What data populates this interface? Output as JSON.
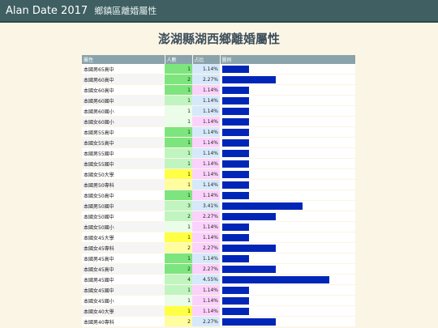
{
  "app": {
    "title": "Alan Date 2017",
    "subtitle": "鄉鎮區離婚屬性"
  },
  "page": {
    "heading": "澎湖縣湖西鄉離婚屬性"
  },
  "table": {
    "columns": [
      "屬性",
      "人數",
      "占比",
      "圖例"
    ],
    "max_value": 4,
    "colors": {
      "count_yellow": "#ffff44",
      "count_green_dark": "#7de57d",
      "count_green_mid": "#c0f5c0",
      "count_green_light": "#eafde8",
      "pct_pink": "#fbd2fb",
      "pct_blue": "#d6e9fb",
      "bar": "#0026b8"
    },
    "rows": [
      {
        "name": "本國男65高中",
        "count": "1",
        "pct": "1.14%",
        "value": 1,
        "count_color": "#7de57d",
        "pct_color": "#d6e9fb"
      },
      {
        "name": "本國男60高中",
        "count": "2",
        "pct": "2.27%",
        "value": 2,
        "count_color": "#7de57d",
        "pct_color": "#d6e9fb"
      },
      {
        "name": "本國女60高中",
        "count": "1",
        "pct": "1.14%",
        "value": 1,
        "count_color": "#7de57d",
        "pct_color": "#fbd2fb"
      },
      {
        "name": "本國男60國中",
        "count": "1",
        "pct": "1.14%",
        "value": 1,
        "count_color": "#c0f5c0",
        "pct_color": "#d6e9fb"
      },
      {
        "name": "本國男60國小",
        "count": "1",
        "pct": "1.14%",
        "value": 1,
        "count_color": "#eafde8",
        "pct_color": "#d6e9fb"
      },
      {
        "name": "本國女60國小",
        "count": "1",
        "pct": "1.14%",
        "value": 1,
        "count_color": "#eafde8",
        "pct_color": "#fbd2fb"
      },
      {
        "name": "本國男55高中",
        "count": "1",
        "pct": "1.14%",
        "value": 1,
        "count_color": "#7de57d",
        "pct_color": "#d6e9fb"
      },
      {
        "name": "本國女55高中",
        "count": "1",
        "pct": "1.14%",
        "value": 1,
        "count_color": "#7de57d",
        "pct_color": "#fbd2fb"
      },
      {
        "name": "本國男55國中",
        "count": "1",
        "pct": "1.14%",
        "value": 1,
        "count_color": "#c0f5c0",
        "pct_color": "#d6e9fb"
      },
      {
        "name": "本國女55國中",
        "count": "1",
        "pct": "1.14%",
        "value": 1,
        "count_color": "#c0f5c0",
        "pct_color": "#fbd2fb"
      },
      {
        "name": "本國女50大學",
        "count": "1",
        "pct": "1.14%",
        "value": 1,
        "count_color": "#ffff44",
        "pct_color": "#fbd2fb"
      },
      {
        "name": "本國男50專科",
        "count": "1",
        "pct": "1.14%",
        "value": 1,
        "count_color": "#fffd9e",
        "pct_color": "#d6e9fb"
      },
      {
        "name": "本國女50高中",
        "count": "1",
        "pct": "1.14%",
        "value": 1,
        "count_color": "#7de57d",
        "pct_color": "#fbd2fb"
      },
      {
        "name": "本國男50國中",
        "count": "3",
        "pct": "3.41%",
        "value": 3,
        "count_color": "#c0f5c0",
        "pct_color": "#d6e9fb"
      },
      {
        "name": "本國女50國中",
        "count": "2",
        "pct": "2.27%",
        "value": 2,
        "count_color": "#c0f5c0",
        "pct_color": "#fbd2fb"
      },
      {
        "name": "本國女50國小",
        "count": "1",
        "pct": "1.14%",
        "value": 1,
        "count_color": "#eafde8",
        "pct_color": "#fbd2fb"
      },
      {
        "name": "本國女45大學",
        "count": "1",
        "pct": "1.14%",
        "value": 1,
        "count_color": "#ffff44",
        "pct_color": "#fbd2fb"
      },
      {
        "name": "本國女45專科",
        "count": "2",
        "pct": "2.27%",
        "value": 2,
        "count_color": "#fffd9e",
        "pct_color": "#fbd2fb"
      },
      {
        "name": "本國男45高中",
        "count": "1",
        "pct": "1.14%",
        "value": 1,
        "count_color": "#7de57d",
        "pct_color": "#d6e9fb"
      },
      {
        "name": "本國女45高中",
        "count": "2",
        "pct": "2.27%",
        "value": 2,
        "count_color": "#7de57d",
        "pct_color": "#fbd2fb"
      },
      {
        "name": "本國男45國中",
        "count": "4",
        "pct": "4.55%",
        "value": 4,
        "count_color": "#c0f5c0",
        "pct_color": "#d6e9fb"
      },
      {
        "name": "本國女45國中",
        "count": "1",
        "pct": "1.14%",
        "value": 1,
        "count_color": "#c0f5c0",
        "pct_color": "#fbd2fb"
      },
      {
        "name": "本國女45國小",
        "count": "1",
        "pct": "1.14%",
        "value": 1,
        "count_color": "#eafde8",
        "pct_color": "#fbd2fb"
      },
      {
        "name": "本國女40大學",
        "count": "1",
        "pct": "1.14%",
        "value": 1,
        "count_color": "#ffff44",
        "pct_color": "#fbd2fb"
      },
      {
        "name": "本國男40專科",
        "count": "2",
        "pct": "2.27%",
        "value": 2,
        "count_color": "#fffd9e",
        "pct_color": "#d6e9fb"
      }
    ]
  }
}
